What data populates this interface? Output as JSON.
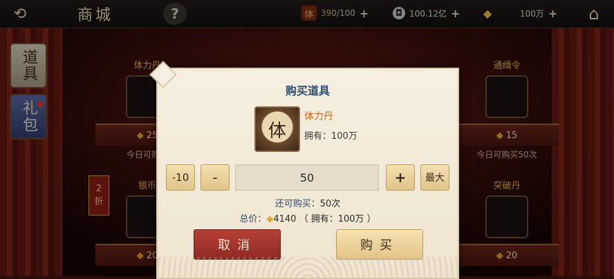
{
  "topbar": {
    "title": "商城",
    "back_icon": "back-arrow-icon",
    "help_label": "?",
    "home_icon": "home-icon",
    "stamina": {
      "icon_label": "体",
      "value": "390",
      "max": "/100"
    },
    "silver": {
      "value": "100.12亿"
    },
    "gold": {
      "value": "100万"
    },
    "plus_label": "+"
  },
  "sidebar": {
    "tab_props": "道具",
    "tab_gifts": "礼包"
  },
  "shop": {
    "discount": {
      "num": "2",
      "unit": "折"
    },
    "cards": [
      {
        "name": "体力丹",
        "price": "25",
        "note": "今日可购买"
      },
      {
        "name": "通缉令",
        "price": "15",
        "note": "今日可购买50次"
      },
      {
        "name": "银币",
        "price": "20",
        "note": ""
      },
      {
        "name": "突破丹",
        "price": "20",
        "note": ""
      }
    ]
  },
  "dialog": {
    "title": "购买道具",
    "item_name": "体力丹",
    "item_glyph": "体",
    "owned_label": "拥有：",
    "owned_value": "100万",
    "btn_minus10": "-10",
    "btn_minus": "-",
    "quantity": "50",
    "btn_plus": "+",
    "btn_max": "最大",
    "remain_label": "还可购买：",
    "remain_value": "50次",
    "total_label": "总价：",
    "total_value": "4140",
    "total_owned": "（ 拥有：100万 ）",
    "cancel_label": "取消",
    "buy_label": "购买"
  },
  "colors": {
    "accent_orange": "#d9651b",
    "title_blue": "#2f4d6e",
    "cancel_red": "#8d2a24",
    "gold": "#e2a82a"
  }
}
